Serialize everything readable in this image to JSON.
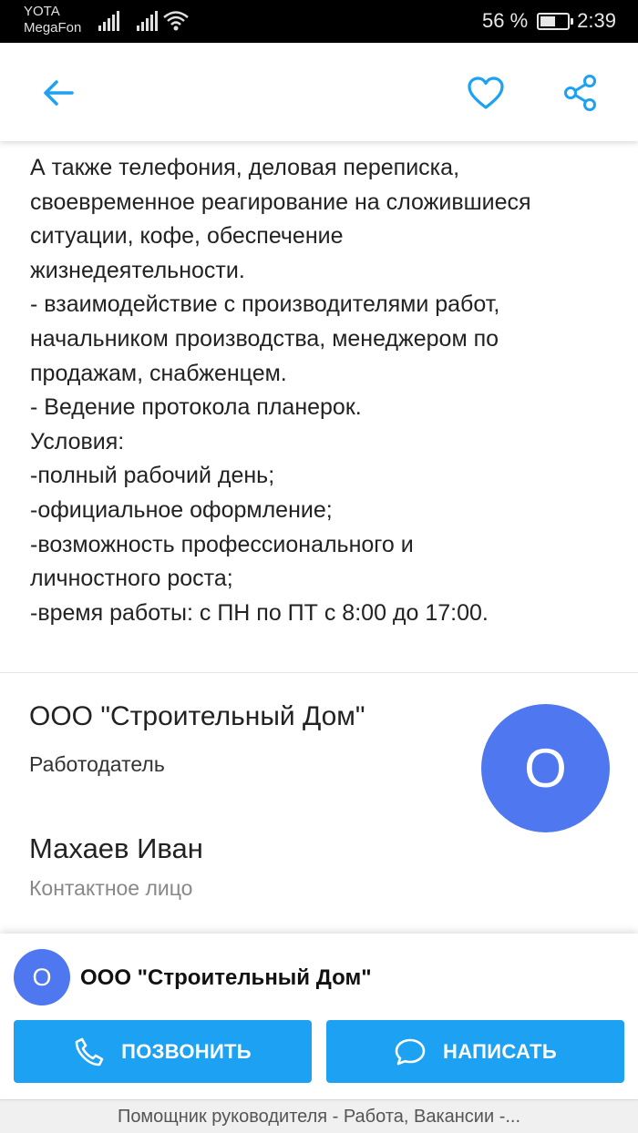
{
  "status_bar": {
    "carrier_1": "YOTA",
    "carrier_2": "MegaFon",
    "battery_text": "56 %",
    "battery_level": 0.56,
    "time": "2:39"
  },
  "app_bar": {
    "back_icon": "arrow-left-icon",
    "favorite_icon": "heart-icon",
    "share_icon": "share-icon",
    "accent_color": "#1da1f2"
  },
  "description": {
    "lines": [
      "А также телефония, деловая переписка,",
      "своевременное реагирование на сложившиеся",
      "ситуации, кофе, обеспечение",
      "жизнедеятельности.",
      "- взаимодействие с производителями работ,",
      "начальником производства, менеджером по",
      "продажам, снабженцем.",
      "- Ведение протокола планерок.",
      "Условия:",
      "-полный рабочий день;",
      "-официальное оформление;",
      "-возможность профессионального и",
      "личностного роста;",
      "-время работы: с ПН по ПТ с 8:00 до 17:00."
    ]
  },
  "employer": {
    "name": "ООО \"Строительный Дом\"",
    "role": "Работодатель",
    "avatar_letter": "О",
    "avatar_color": "#4f78f0"
  },
  "contact": {
    "name": "Махаев Иван",
    "role": "Контактное лицо"
  },
  "bottom_panel": {
    "avatar_letter": "О",
    "title": "ООО \"Строительный Дом\"",
    "call_label": "ПОЗВОНИТЬ",
    "write_label": "НАПИСАТЬ",
    "button_color": "#1da1f2"
  },
  "footer": {
    "text": "Помощник руководителя - Работа, Вакансии -..."
  }
}
